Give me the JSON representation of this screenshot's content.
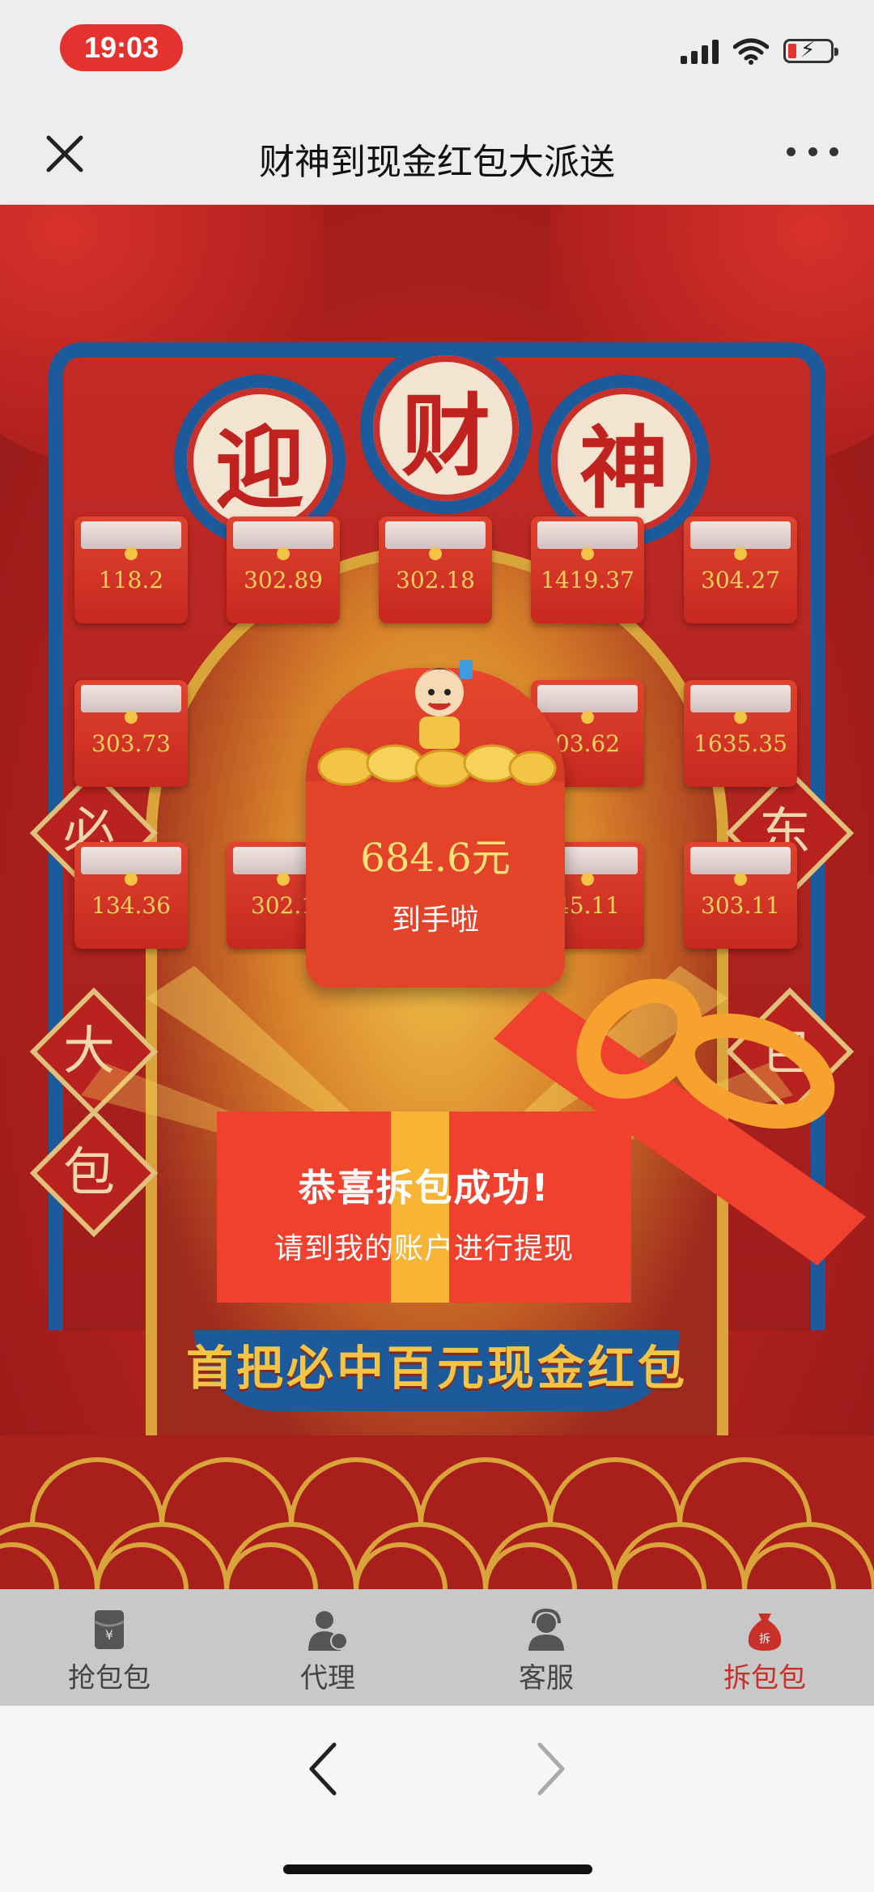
{
  "status_bar": {
    "time": "19:03",
    "icons": [
      "signal-icon",
      "wifi-icon",
      "battery-charging-icon"
    ],
    "time_pill_color": "#e4332f"
  },
  "nav": {
    "title": "财神到现金红包大派送",
    "close_icon": "close-icon",
    "more_icon": "more-icon"
  },
  "banner": {
    "header_chars": [
      "迎",
      "财",
      "神"
    ],
    "envelopes": [
      "118.2",
      "302.89",
      "302.18",
      "1419.37",
      "304.27",
      "303.73",
      "03.62",
      "1635.35",
      "134.36",
      "302.1",
      "45.11",
      "303.11"
    ],
    "side_left_chars": [
      "必",
      "大",
      "包"
    ],
    "side_right_chars": [
      "东",
      "包"
    ],
    "popup": {
      "amount": "684.6元",
      "label": "到手啦"
    },
    "gift": {
      "line1": "恭喜拆包成功!",
      "line2": "请到我的账户进行提现"
    },
    "slogan": "首把必中百元现金红包",
    "accent_red": "#c9302a",
    "accent_gold": "#f3c445"
  },
  "tabs": [
    {
      "label": "抢包包",
      "icon": "red-envelope-icon",
      "active": false
    },
    {
      "label": "代理",
      "icon": "agent-user-icon",
      "active": false
    },
    {
      "label": "客服",
      "icon": "customer-service-icon",
      "active": false
    },
    {
      "label": "拆包包",
      "icon": "money-bag-icon",
      "active": true
    }
  ],
  "browser": {
    "back_icon": "back-arrow-icon",
    "forward_icon": "forward-arrow-icon"
  }
}
